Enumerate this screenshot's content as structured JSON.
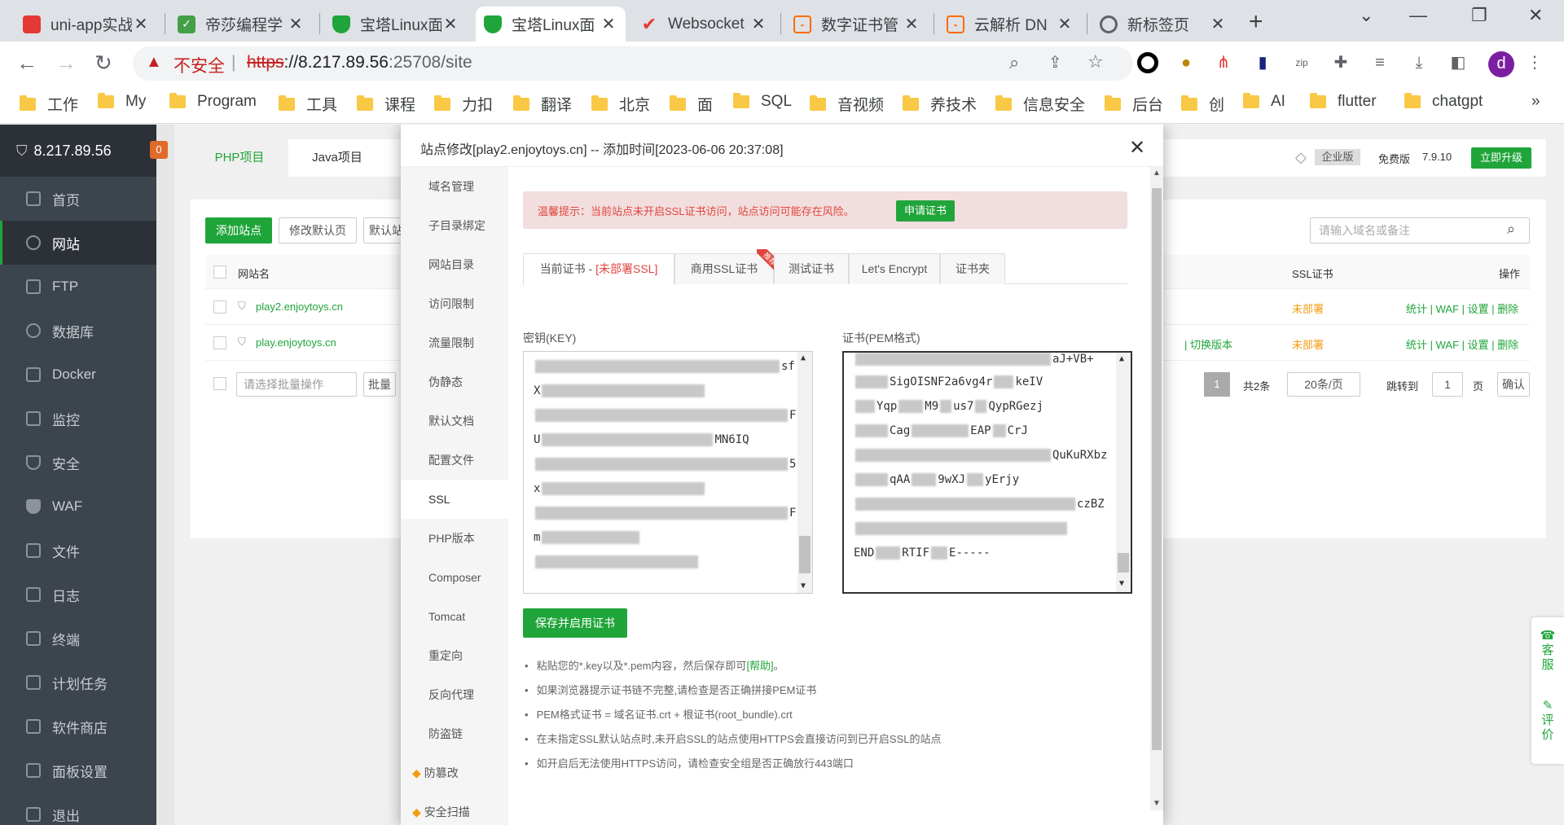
{
  "tabs": [
    {
      "title": "uni-app实战",
      "color": "#e53935",
      "active": false
    },
    {
      "title": "帝莎编程学",
      "color": "#43a047",
      "active": false
    },
    {
      "title": "宝塔Linux面",
      "color": "#20a53a",
      "active": false
    },
    {
      "title": "宝塔Linux面",
      "color": "#20a53a",
      "active": true
    },
    {
      "title": "Websocket",
      "color": "#e53935",
      "active": false
    },
    {
      "title": "数字证书管",
      "color": "#ff6a00",
      "active": false
    },
    {
      "title": "云解析 DN",
      "color": "#ff6a00",
      "active": false
    },
    {
      "title": "新标签页",
      "color": "#5f6368",
      "active": false
    }
  ],
  "address": {
    "insecure_label": "不安全",
    "url_scheme": "https",
    "url_host": "://8.217.89.56",
    "url_path": ":25708/site"
  },
  "bookmarks": [
    "工作",
    "My",
    "Program",
    "工具",
    "课程",
    "力扣",
    "翻译",
    "北京",
    "面",
    "SQL",
    "音视频",
    "养技术",
    "信息安全",
    "后台",
    "创",
    "AI",
    "flutter",
    "chatgpt"
  ],
  "sidebar": {
    "server": "8.217.89.56",
    "badge": "0",
    "items": [
      {
        "label": "首页",
        "icon": "home-icon"
      },
      {
        "label": "网站",
        "icon": "globe-icon",
        "active": true
      },
      {
        "label": "FTP",
        "icon": "ftp-icon"
      },
      {
        "label": "数据库",
        "icon": "database-icon"
      },
      {
        "label": "Docker",
        "icon": "docker-icon"
      },
      {
        "label": "监控",
        "icon": "monitor-icon"
      },
      {
        "label": "安全",
        "icon": "shield-icon"
      },
      {
        "label": "WAF",
        "icon": "waf-icon"
      },
      {
        "label": "文件",
        "icon": "folder-icon"
      },
      {
        "label": "日志",
        "icon": "log-icon"
      },
      {
        "label": "终端",
        "icon": "terminal-icon"
      },
      {
        "label": "计划任务",
        "icon": "calendar-icon"
      },
      {
        "label": "软件商店",
        "icon": "store-icon"
      },
      {
        "label": "面板设置",
        "icon": "settings-icon"
      },
      {
        "label": "退出",
        "icon": "logout-icon"
      }
    ]
  },
  "background": {
    "tab_php": "PHP项目",
    "tab_java": "Java项目",
    "add_site": "添加站点",
    "edit_default": "修改默认页",
    "default_site": "默认站",
    "search_placeholder": "请输入域名或备注",
    "col_name": "网站名",
    "col_ssl": "SSL证书",
    "col_op": "操作",
    "rows": [
      {
        "name": "play2.enjoytoys.cn",
        "ssl": "未部署",
        "ops": [
          "统计",
          "WAF",
          "设置",
          "删除"
        ]
      },
      {
        "name": "play.enjoytoys.cn",
        "ssl": "未部署",
        "ops": [
          "统计",
          "WAF",
          "设置",
          "删除"
        ],
        "switch": "切换版本"
      }
    ],
    "batch_select": "请选择批量操作",
    "batch_btn": "批量",
    "page_num": "1",
    "total": "共2条",
    "per_page": "20条/页",
    "jump_label": "跳转到",
    "jump_val": "1",
    "page_suffix": "页",
    "confirm": "确认",
    "edition": "企业版",
    "free": "免费版",
    "version": "7.9.10",
    "upgrade": "立即升级"
  },
  "modal": {
    "title": "站点修改[play2.enjoytoys.cn] -- 添加时间[2023-06-06 20:37:08]",
    "nav": [
      "域名管理",
      "子目录绑定",
      "网站目录",
      "访问限制",
      "流量限制",
      "伪静态",
      "默认文档",
      "配置文件",
      "SSL",
      "PHP版本",
      "Composer",
      "Tomcat",
      "重定向",
      "反向代理",
      "防盗链",
      "防篡改",
      "安全扫描"
    ],
    "nav_active": 8,
    "warning": "温馨提示：当前站点未开启SSL证书访问，站点访问可能存在风险。",
    "apply_cert": "申请证书",
    "cert_tabs": [
      {
        "label": "当前证书 - ",
        "extra": "[未部署SSL]",
        "active": true
      },
      {
        "label": "商用SSL证书",
        "ribbon": "推荐"
      },
      {
        "label": "测试证书"
      },
      {
        "label": "Let's Encrypt"
      },
      {
        "label": "证书夹"
      }
    ],
    "key_label": "密钥(KEY)",
    "cert_label": "证书(PEM格式)",
    "key_lines": [
      "sf",
      "X",
      "F",
      "U",
      "MN6IQ",
      "5",
      "x",
      "F",
      "m",
      ""
    ],
    "cert_lines": [
      "aJ+VB+",
      "SigOISNF2a6vg4r",
      "keIV",
      "Yqp",
      "M9",
      "us7",
      "Qy",
      "pRGezj",
      "Cag",
      "EAP",
      "CrJ",
      "QuKuRXbz",
      "qAA",
      "9wXJ",
      "yErjy",
      "czBZ",
      "END",
      "RTIF",
      "E-----"
    ],
    "save_btn": "保存并启用证书",
    "tips": [
      {
        "text": "粘贴您的*.key以及*.pem内容，然后保存即可",
        "link": "[帮助]",
        "end": "。"
      },
      {
        "text": "如果浏览器提示证书链不完整,请检查是否正确拼接PEM证书"
      },
      {
        "text": "PEM格式证书 = 域名证书.crt + 根证书(root_bundle).crt"
      },
      {
        "text": "在未指定SSL默认站点时,未开启SSL的站点使用HTTPS会直接访问到已开启SSL的站点"
      },
      {
        "text": "如开启后无法使用HTTPS访问，请检查安全组是否正确放行443端口"
      }
    ]
  },
  "float": {
    "service": "客服",
    "rate": "评价"
  }
}
